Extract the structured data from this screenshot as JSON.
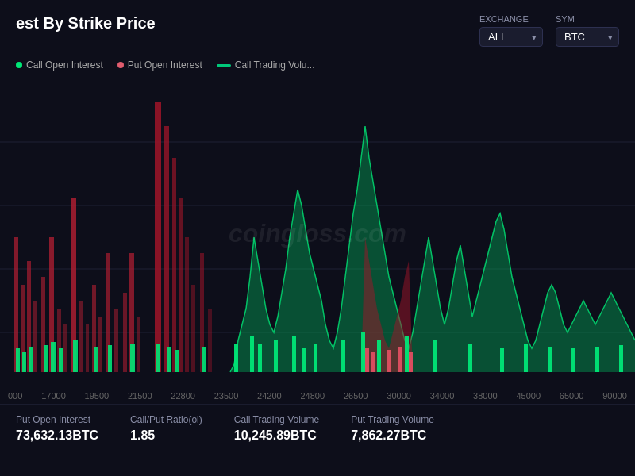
{
  "header": {
    "title": "est By Strike Price",
    "exchange_label": "Exchange",
    "exchange_value": "ALL",
    "symbol_label": "Sym",
    "symbol_value": "BTC"
  },
  "legend": [
    {
      "label": "Call Open Interest",
      "color": "#00c87a",
      "type": "dot"
    },
    {
      "label": "Put  Open Interest",
      "color": "#e05c6e",
      "type": "dot"
    },
    {
      "label": "Call Trading Volu...",
      "color": "#00c87a",
      "type": "dash"
    }
  ],
  "xAxis": [
    "000",
    "17000",
    "19500",
    "21500",
    "22800",
    "23500",
    "24200",
    "24800",
    "26500",
    "30000",
    "34000",
    "38000",
    "45000",
    "65000",
    "90000"
  ],
  "stats": [
    {
      "label": "Put Open Interest",
      "value": "73,632.13BTC"
    },
    {
      "label": "Call/Put Ratio(oi)",
      "value": "1.85"
    },
    {
      "label": "Call Trading Volume",
      "value": "10,245.89BTC"
    },
    {
      "label": "Put Trading Volume",
      "value": "7,862.27BTC"
    }
  ],
  "watermark": "coingloss.com"
}
